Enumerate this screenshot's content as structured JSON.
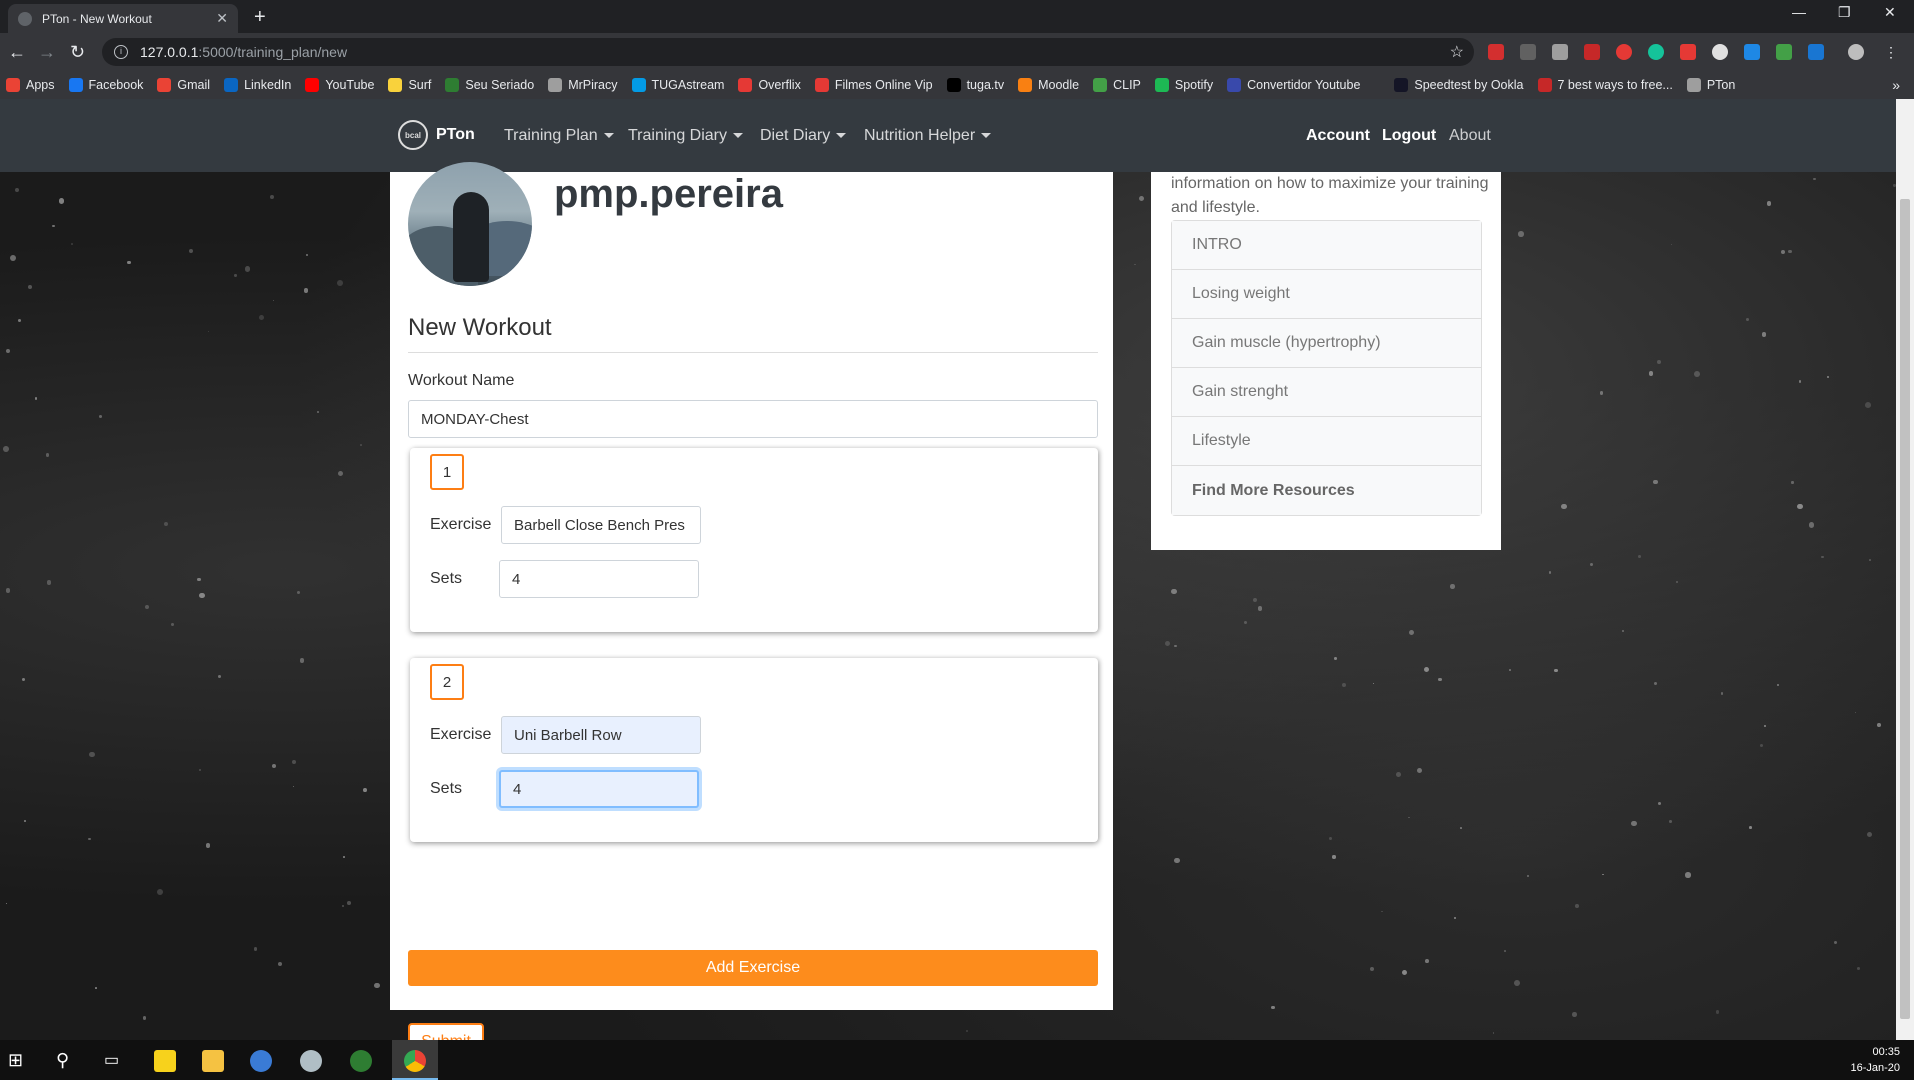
{
  "browser": {
    "tab_title": "PTon - New Workout",
    "url_host": "127.0.0.1",
    "url_path": ":5000/training_plan/new",
    "bookmarks": [
      {
        "label": "Apps",
        "color": "#ea4335"
      },
      {
        "label": "Facebook",
        "color": "#1877f2"
      },
      {
        "label": "Gmail",
        "color": "#ea4335"
      },
      {
        "label": "LinkedIn",
        "color": "#0a66c2"
      },
      {
        "label": "YouTube",
        "color": "#ff0000"
      },
      {
        "label": "Surf",
        "color": "#f9d23c"
      },
      {
        "label": "Seu Seriado",
        "color": "#2e7d32"
      },
      {
        "label": "MrPiracy",
        "color": "#9e9e9e"
      },
      {
        "label": "TUGAstream",
        "color": "#039be5"
      },
      {
        "label": "Overflix",
        "color": "#e53935"
      },
      {
        "label": "Filmes Online Vip",
        "color": "#e53935"
      },
      {
        "label": "tuga.tv",
        "color": "#000000"
      },
      {
        "label": "Moodle",
        "color": "#f98012"
      },
      {
        "label": "CLIP",
        "color": "#43a047"
      },
      {
        "label": "Spotify",
        "color": "#1db954"
      },
      {
        "label": "Convertidor Youtube",
        "color": "#3949ab"
      },
      {
        "label": "Speedtest by Ookla",
        "color": "#141526"
      },
      {
        "label": "7 best ways to free...",
        "color": "#c62828"
      },
      {
        "label": "PTon",
        "color": "#9e9e9e"
      }
    ]
  },
  "navbar": {
    "brand": "PTon",
    "logo_text": "bcal",
    "items": [
      {
        "label": "Training Plan"
      },
      {
        "label": "Training Diary"
      },
      {
        "label": "Diet Diary"
      },
      {
        "label": "Nutrition Helper"
      }
    ],
    "account": "Account",
    "logout": "Logout",
    "about": "About"
  },
  "profile": {
    "username": "pmp.pereira"
  },
  "form": {
    "heading": "New Workout",
    "workout_name_label": "Workout Name",
    "workout_name_value": "MONDAY-Chest",
    "exercise_label": "Exercise",
    "sets_label": "Sets",
    "exercises": [
      {
        "number": "1",
        "exercise": "Barbell Close Bench Pres",
        "sets": "4"
      },
      {
        "number": "2",
        "exercise": "Uni Barbell Row",
        "sets": "4"
      }
    ],
    "add_exercise": "Add Exercise",
    "submit": "Submit"
  },
  "sidebar": {
    "text": "information on how to maximize your training and lifestyle.",
    "items": [
      {
        "label": "INTRO"
      },
      {
        "label": "Losing weight"
      },
      {
        "label": "Gain muscle (hypertrophy)"
      },
      {
        "label": "Gain strenght"
      },
      {
        "label": "Lifestyle"
      },
      {
        "label": "Find More Resources"
      }
    ]
  },
  "taskbar": {
    "time": "00:35",
    "date": "16-Jan-20"
  },
  "colors": {
    "accent": "#fd7e14",
    "navbar": "#343a40"
  }
}
